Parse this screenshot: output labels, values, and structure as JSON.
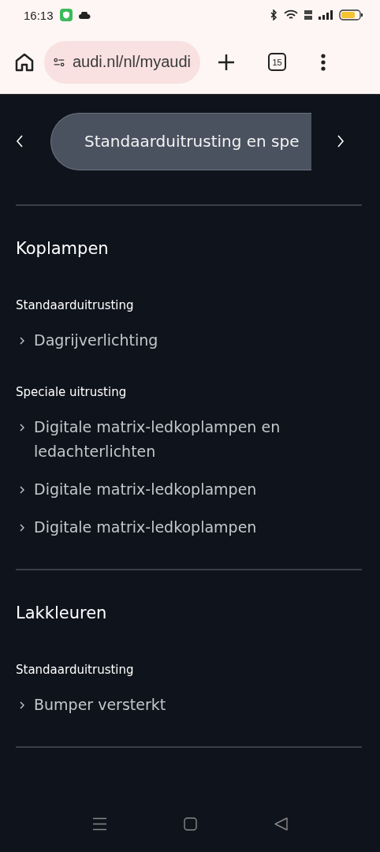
{
  "status_bar": {
    "time": "16:13"
  },
  "browser": {
    "url": "audi.nl/nl/myaudi",
    "tab_count": "15"
  },
  "carousel": {
    "label": "Standaarduitrusting en spe"
  },
  "sections": [
    {
      "title": "Koplampen",
      "groups": [
        {
          "title": "Standaarduitrusting",
          "items": [
            "Dagrijverlichting"
          ]
        },
        {
          "title": "Speciale uitrusting",
          "items": [
            "Digitale matrix-ledkoplampen en ledachterlichten",
            "Digitale matrix-ledkoplampen",
            "Digitale matrix-ledkoplampen"
          ]
        }
      ]
    },
    {
      "title": "Lakkleuren",
      "groups": [
        {
          "title": "Standaarduitrusting",
          "items": [
            "Bumper versterkt"
          ]
        }
      ]
    }
  ]
}
